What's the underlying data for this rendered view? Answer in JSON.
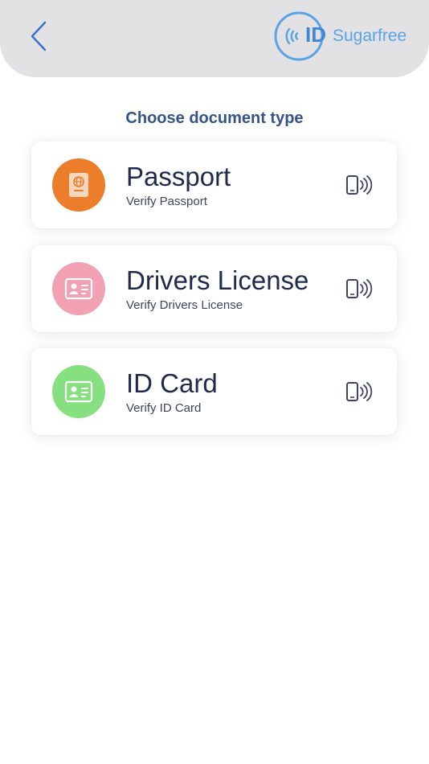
{
  "header": {
    "logo": {
      "id_text": "ID",
      "word": "Sugarfree"
    }
  },
  "main": {
    "title": "Choose document type",
    "documents": [
      {
        "title": "Passport",
        "subtitle": "Verify Passport",
        "icon": "passport-icon",
        "color": "#ec7d2a"
      },
      {
        "title": "Drivers License",
        "subtitle": "Verify Drivers License",
        "icon": "id-card-icon",
        "color": "#f2a1b3"
      },
      {
        "title": "ID Card",
        "subtitle": "Verify ID Card",
        "icon": "id-card-icon",
        "color": "#86e07f"
      }
    ]
  },
  "colors": {
    "header_bg": "#e2e2e4",
    "title": "#34548a",
    "back_arrow": "#3a6fd0",
    "nfc_icon": "#3c4466"
  }
}
